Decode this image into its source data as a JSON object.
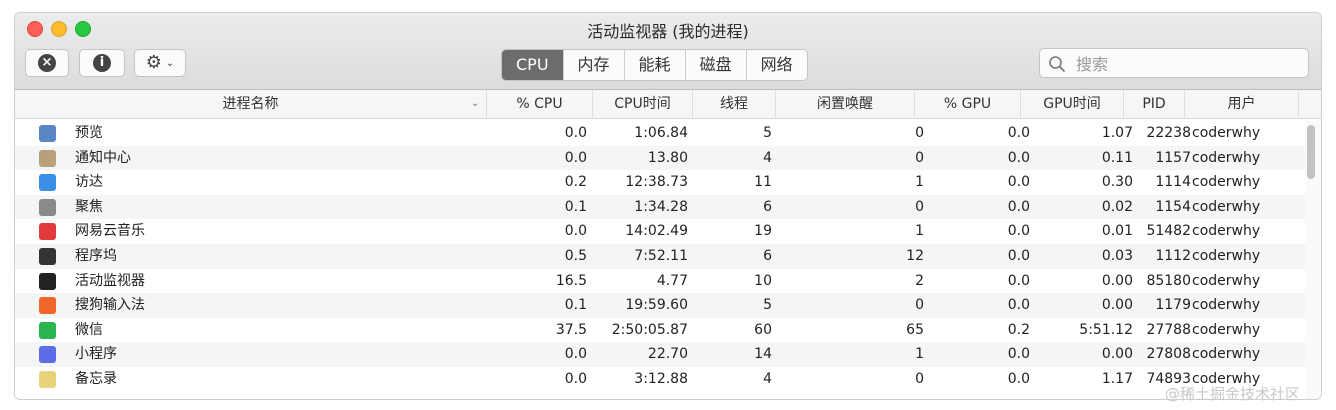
{
  "window": {
    "title": "活动监视器 (我的进程)"
  },
  "toolbar": {
    "stop_icon": "close-circle-icon",
    "info_icon": "info-icon",
    "gear_icon": "gear-icon",
    "info_glyph": "i",
    "stop_glyph": "×",
    "gear_glyph": "⚙",
    "chevron_glyph": "⌄"
  },
  "tabs": [
    {
      "label": "CPU",
      "active": true
    },
    {
      "label": "内存",
      "active": false
    },
    {
      "label": "能耗",
      "active": false
    },
    {
      "label": "磁盘",
      "active": false
    },
    {
      "label": "网络",
      "active": false
    }
  ],
  "search": {
    "placeholder": "搜索"
  },
  "columns": {
    "name": "进程名称",
    "cpu": "% CPU",
    "cpu_time": "CPU时间",
    "threads": "线程",
    "idle_wakeups": "闲置唤醒",
    "gpu": "% GPU",
    "gpu_time": "GPU时间",
    "pid": "PID",
    "user": "用户"
  },
  "processes": [
    {
      "name": "预览",
      "icon": "preview-icon",
      "color": "#5a86c5",
      "cpu": "0.0",
      "cpu_time": "1:06.84",
      "threads": "5",
      "idle": "0",
      "gpu": "0.0",
      "gpu_time": "1.07",
      "pid": "22238",
      "user": "coderwhy"
    },
    {
      "name": "通知中心",
      "icon": "notification-center-icon",
      "color": "#b7a07a",
      "cpu": "0.0",
      "cpu_time": "13.80",
      "threads": "4",
      "idle": "0",
      "gpu": "0.0",
      "gpu_time": "0.11",
      "pid": "1157",
      "user": "coderwhy"
    },
    {
      "name": "访达",
      "icon": "finder-icon",
      "color": "#3a8ee6",
      "cpu": "0.2",
      "cpu_time": "12:38.73",
      "threads": "11",
      "idle": "1",
      "gpu": "0.0",
      "gpu_time": "0.30",
      "pid": "1114",
      "user": "coderwhy"
    },
    {
      "name": "聚焦",
      "icon": "spotlight-icon",
      "color": "#8a8a8a",
      "cpu": "0.1",
      "cpu_time": "1:34.28",
      "threads": "6",
      "idle": "0",
      "gpu": "0.0",
      "gpu_time": "0.02",
      "pid": "1154",
      "user": "coderwhy"
    },
    {
      "name": "网易云音乐",
      "icon": "netease-music-icon",
      "color": "#e03a3a",
      "cpu": "0.0",
      "cpu_time": "14:02.49",
      "threads": "19",
      "idle": "1",
      "gpu": "0.0",
      "gpu_time": "0.01",
      "pid": "51482",
      "user": "coderwhy"
    },
    {
      "name": "程序坞",
      "icon": "dock-icon",
      "color": "#333333",
      "cpu": "0.5",
      "cpu_time": "7:52.11",
      "threads": "6",
      "idle": "12",
      "gpu": "0.0",
      "gpu_time": "0.03",
      "pid": "1112",
      "user": "coderwhy"
    },
    {
      "name": "活动监视器",
      "icon": "activity-monitor-icon",
      "color": "#222222",
      "cpu": "16.5",
      "cpu_time": "4.77",
      "threads": "10",
      "idle": "2",
      "gpu": "0.0",
      "gpu_time": "0.00",
      "pid": "85180",
      "user": "coderwhy"
    },
    {
      "name": "搜狗输入法",
      "icon": "sogou-input-icon",
      "color": "#f0662a",
      "cpu": "0.1",
      "cpu_time": "19:59.60",
      "threads": "5",
      "idle": "0",
      "gpu": "0.0",
      "gpu_time": "0.00",
      "pid": "1179",
      "user": "coderwhy"
    },
    {
      "name": "微信",
      "icon": "wechat-icon",
      "color": "#2ab550",
      "cpu": "37.5",
      "cpu_time": "2:50:05.87",
      "threads": "60",
      "idle": "65",
      "gpu": "0.2",
      "gpu_time": "5:51.12",
      "pid": "27788",
      "user": "coderwhy"
    },
    {
      "name": "小程序",
      "icon": "mini-program-icon",
      "color": "#5b6ee8",
      "cpu": "0.0",
      "cpu_time": "22.70",
      "threads": "14",
      "idle": "1",
      "gpu": "0.0",
      "gpu_time": "0.00",
      "pid": "27808",
      "user": "coderwhy"
    },
    {
      "name": "备忘录",
      "icon": "notes-icon",
      "color": "#e8d27a",
      "cpu": "0.0",
      "cpu_time": "3:12.88",
      "threads": "4",
      "idle": "0",
      "gpu": "0.0",
      "gpu_time": "1.17",
      "pid": "74893",
      "user": "coderwhy"
    }
  ],
  "watermark": "@稀土掘金技术社区"
}
